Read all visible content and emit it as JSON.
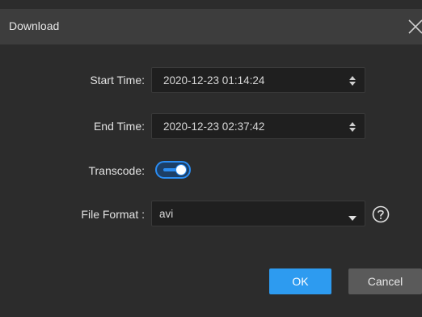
{
  "dialog": {
    "title": "Download",
    "start_time": {
      "label": "Start Time:",
      "value": "2020-12-23 01:14:24"
    },
    "end_time": {
      "label": "End Time:",
      "value": "2020-12-23 02:37:42"
    },
    "transcode": {
      "label": "Transcode:",
      "enabled": true
    },
    "file_format": {
      "label": "File Format :",
      "value": "avi"
    },
    "ok_label": "OK",
    "cancel_label": "Cancel"
  },
  "colors": {
    "accent": "#2d9bf0",
    "background": "#2c2c2c",
    "titlebar": "#3d3d3d",
    "cancel_button": "#5a5a5a"
  },
  "icons": [
    "close-icon",
    "spinner-icon",
    "chevron-down-icon",
    "help-icon"
  ]
}
